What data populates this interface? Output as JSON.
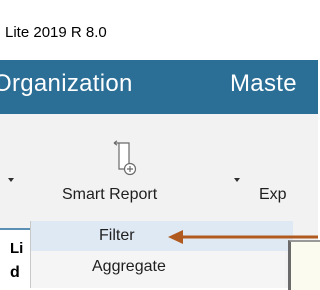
{
  "titlebar": {
    "title": "Lite 2019 R 8.0"
  },
  "menubar": {
    "items": [
      "Organization",
      "Maste"
    ]
  },
  "ribbon": {
    "smart_report_label": "Smart Report",
    "export_label": "Exp",
    "smart_report_icon": "smart-report-icon"
  },
  "left_panel": {
    "text_top": "Li",
    "text_bottom": "d"
  },
  "dropdown": {
    "items": [
      "Filter",
      "Aggregate"
    ],
    "highlighted": "Filter"
  },
  "annotation": {
    "arrow_color": "#b05a1f"
  },
  "colors": {
    "menubar": "#2b6e96",
    "highlight": "#dfe9f4"
  }
}
